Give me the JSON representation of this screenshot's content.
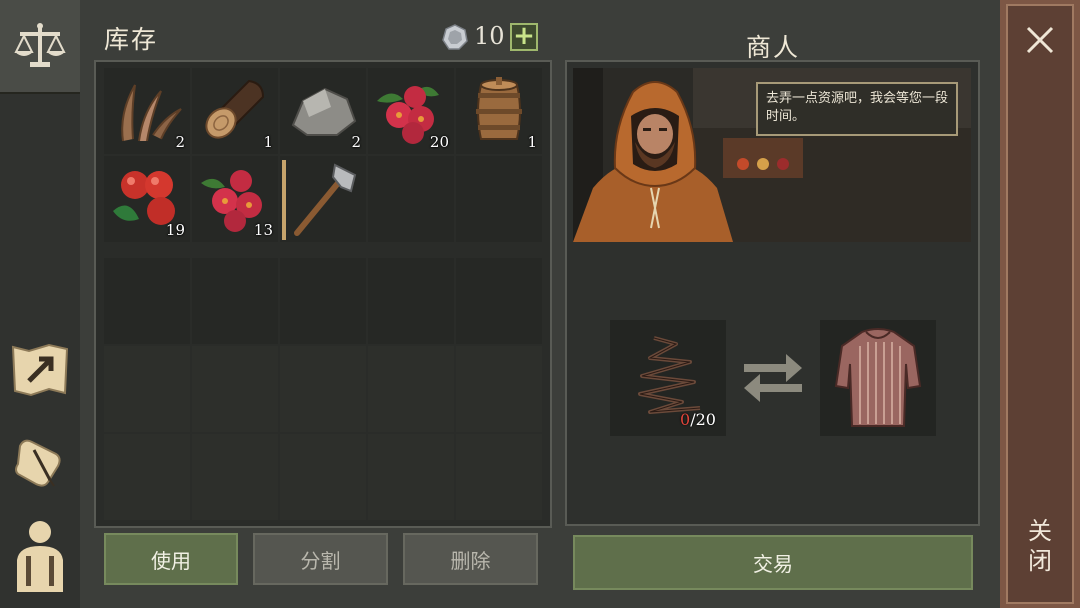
{
  "inventory": {
    "title": "库存",
    "coin_count": "10",
    "items": [
      {
        "name": "fiber",
        "qty": "2"
      },
      {
        "name": "log",
        "qty": "1"
      },
      {
        "name": "stone",
        "qty": "2"
      },
      {
        "name": "berries",
        "qty": "20"
      },
      {
        "name": "barrel",
        "qty": "1"
      },
      {
        "name": "apples",
        "qty": "19"
      },
      {
        "name": "berries",
        "qty": "13"
      },
      {
        "name": "hatchet",
        "qty": ""
      }
    ]
  },
  "actions": {
    "use_label": "使用",
    "split_label": "分割",
    "delete_label": "删除"
  },
  "merchant": {
    "title": "商人",
    "dialog": "去弄一点资源吧，我会等您一段时间。",
    "trade_have": "0",
    "trade_need": "/20",
    "trade_label": "交易"
  },
  "close_label": "关闭",
  "colors": {
    "accent_green": "#5f6f4b",
    "close_red": "#7d5745",
    "deficit_red": "#e0443a"
  }
}
